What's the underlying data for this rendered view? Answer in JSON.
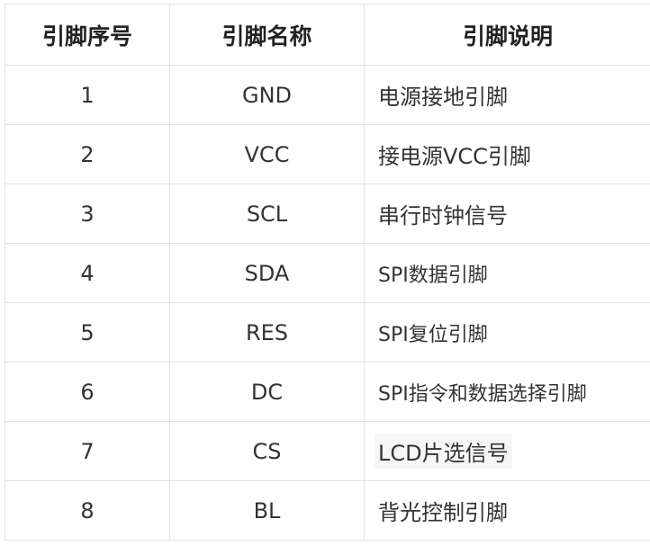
{
  "table": {
    "headers": [
      "引脚序号",
      "引脚名称",
      "引脚说明"
    ],
    "rows": [
      {
        "num": "1",
        "name": "GND",
        "desc": "电源接地引脚"
      },
      {
        "num": "2",
        "name": "VCC",
        "desc": "接电源VCC引脚"
      },
      {
        "num": "3",
        "name": "SCL",
        "desc": "串行时钟信号"
      },
      {
        "num": "4",
        "name": "SDA",
        "desc": "SPI数据引脚"
      },
      {
        "num": "5",
        "name": "RES",
        "desc": "SPI复位引脚"
      },
      {
        "num": "6",
        "name": "DC",
        "desc": "SPI指令和数据选择引脚"
      },
      {
        "num": "7",
        "name": "CS",
        "desc": "LCD片选信号"
      },
      {
        "num": "8",
        "name": "BL",
        "desc": "背光控制引脚"
      }
    ]
  }
}
